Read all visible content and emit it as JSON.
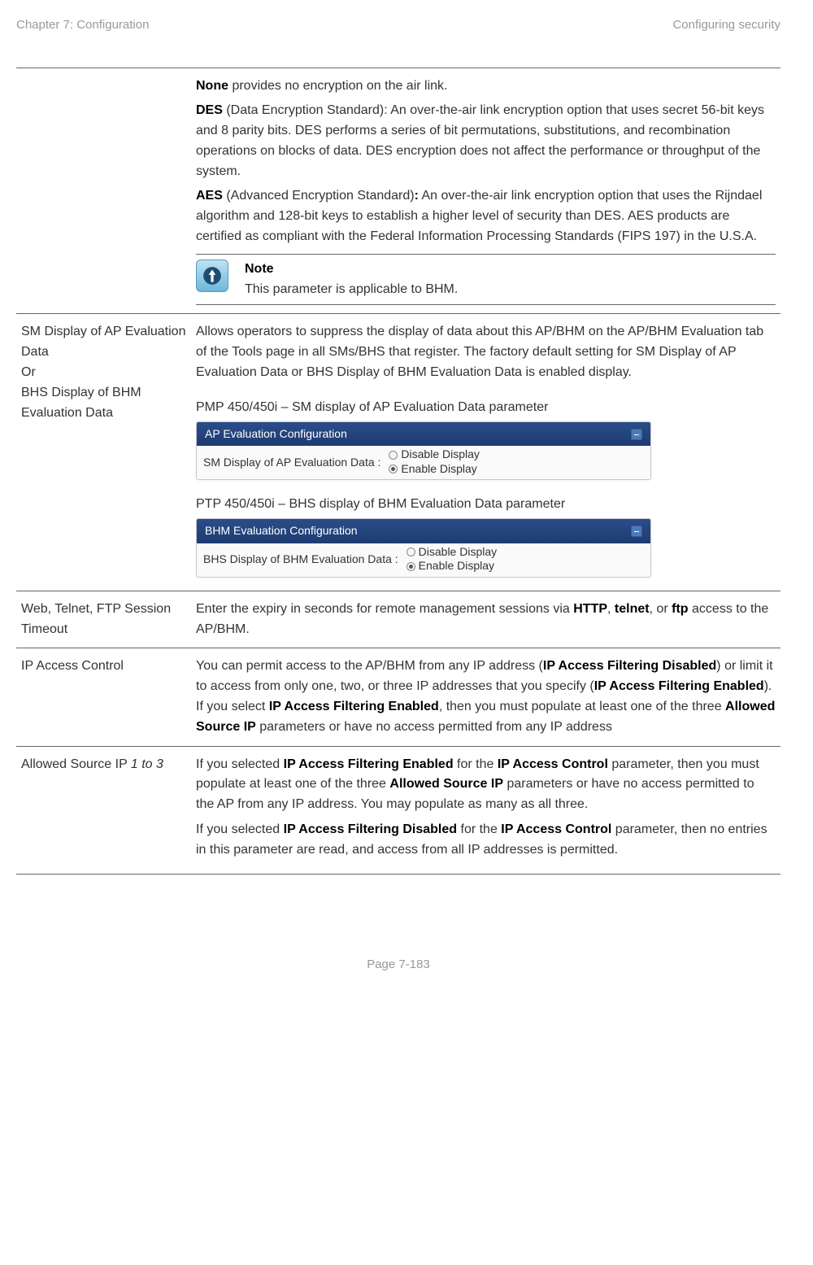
{
  "header": {
    "chapter": "Chapter 7:  Configuration",
    "section": "Configuring security"
  },
  "rows": {
    "encryption": {
      "none_bold": "None",
      "none_text": " provides no encryption on the air link.",
      "des_bold": "DES",
      "des_text": " (Data Encryption Standard): An over-the-air link encryption option that uses secret 56-bit keys and 8 parity bits. DES performs a series of bit permutations, substitutions, and recombination operations on blocks of data. DES encryption does not affect the performance or throughput of the system.",
      "aes_bold": "AES",
      "aes_prefix": " (Advanced Encryption Standard)",
      "aes_colon": ":",
      "aes_text": " An over-the-air link encryption option that uses the Rijndael algorithm and 128-bit keys to establish a higher level of security than DES. AES products are certified as compliant with the Federal Information Processing Standards (FIPS 197) in the U.S.A.",
      "note_title": "Note",
      "note_text": "This parameter is applicable to BHM."
    },
    "sm_display": {
      "label_1": "SM Display of AP Evaluation Data",
      "label_or": "Or",
      "label_2": "BHS Display of BHM Evaluation Data",
      "desc": "Allows operators to suppress the display of data about this AP/BHM on the AP/BHM Evaluation tab of the Tools page in all SMs/BHS that register. The factory default setting for SM Display of AP Evaluation Data or BHS Display of BHM Evaluation Data is enabled display.",
      "caption1": "PMP 450/450i – SM display of AP Evaluation Data parameter",
      "panel1_header": "AP Evaluation Configuration",
      "panel1_label": "SM Display of AP Evaluation Data :",
      "disable": "Disable Display",
      "enable": "Enable Display",
      "caption2": "PTP 450/450i – BHS display of BHM Evaluation Data parameter",
      "panel2_header": "BHM Evaluation Configuration",
      "panel2_label": "BHS Display of BHM Evaluation Data :"
    },
    "timeout": {
      "label": "Web, Telnet, FTP Session Timeout",
      "desc_1": "Enter the expiry in seconds for remote management sessions via ",
      "http": "HTTP",
      "sep1": ", ",
      "telnet": "telnet",
      "sep2": ", or ",
      "ftp": "ftp",
      "desc_2": " access to the AP/BHM."
    },
    "ipaccess": {
      "label": "IP Access Control",
      "t1": "You can permit access to the AP/BHM from any IP address (",
      "b1": "IP Access Filtering Disabled",
      "t2": ") or limit it to access from only one, two, or three IP addresses that you specify (",
      "b2": "IP Access Filtering Enabled",
      "t3": "). If you select ",
      "b3": "IP Access Filtering Enabled",
      "t4": ", then you must populate at least one of the three ",
      "b4": "Allowed Source IP",
      "t5": " parameters or have no access permitted from any IP address"
    },
    "allowed": {
      "label_a": "Allowed Source IP ",
      "label_b": "1 to 3",
      "p1a": "If you selected ",
      "p1b": "IP Access Filtering Enabled",
      "p1c": " for the ",
      "p1d": "IP Access Control",
      "p1e": " parameter, then you must populate at least one of the three ",
      "p1f": "Allowed Source IP",
      "p1g": " parameters or have no access permitted to the AP from any IP address. You may populate as many as all three.",
      "p2a": "If you selected ",
      "p2b": "IP Access Filtering Disabled",
      "p2c": " for the ",
      "p2d": "IP Access Control",
      "p2e": " parameter, then no entries in this parameter are read, and access from all IP addresses is permitted."
    }
  },
  "footer": "Page 7-183"
}
